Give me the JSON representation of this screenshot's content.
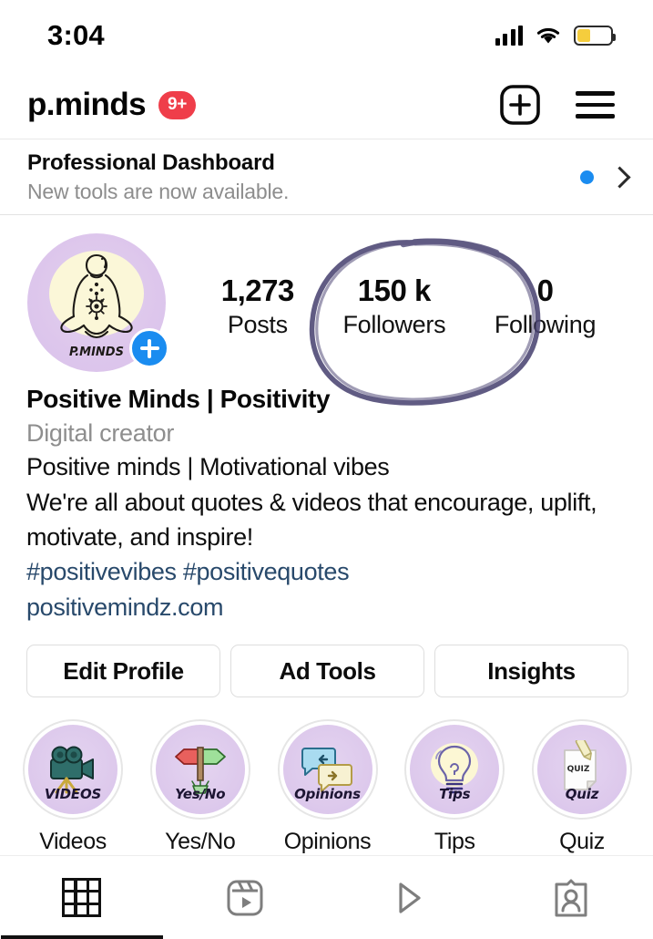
{
  "status_bar": {
    "time": "3:04",
    "signal_icon": "cellular-bars-icon",
    "wifi_icon": "wifi-icon",
    "battery_icon": "battery-icon",
    "battery_level_percent": 40,
    "battery_color": "#f5cd3d"
  },
  "header": {
    "username": "p.minds",
    "notification_badge": "9+",
    "badge_color": "#ef3e4a",
    "add_icon": "plus-square-icon",
    "menu_icon": "hamburger-menu-icon"
  },
  "dashboard": {
    "title": "Professional Dashboard",
    "subtitle": "New tools are now available.",
    "dot_color": "#1a8cf0",
    "chevron_icon": "chevron-right-icon"
  },
  "profile": {
    "avatar_name": "profile-avatar",
    "avatar_caption": "P.MINDS",
    "add_story_icon": "plus-icon",
    "stats": [
      {
        "value": "1,273",
        "label": "Posts"
      },
      {
        "value": "150 k",
        "label": "Followers"
      },
      {
        "value": "0",
        "label": "Following"
      }
    ],
    "annotation": {
      "type": "hand-drawn-circle",
      "color": "#4b4573",
      "targets": "Followers stat"
    }
  },
  "bio": {
    "display_name": "Positive Minds | Positivity",
    "category": "Digital creator",
    "lines": [
      "Positive minds | Motivational vibes",
      "We're all about quotes & videos that encourage, uplift,",
      "motivate, and inspire!"
    ],
    "hashtags": "#positivevibes #positivequotes",
    "website": "positivemindz.com",
    "link_color": "#28496b"
  },
  "actions": [
    {
      "label": "Edit Profile"
    },
    {
      "label": "Ad Tools"
    },
    {
      "label": "Insights"
    }
  ],
  "highlights": [
    {
      "label": "Videos",
      "cover_caption": "VIDEOS",
      "icon": "video-camera-icon"
    },
    {
      "label": "Yes/No",
      "cover_caption": "Yes/No",
      "icon": "signpost-arrows-icon"
    },
    {
      "label": "Opinions",
      "cover_caption": "Opinions",
      "icon": "speech-bubbles-icon"
    },
    {
      "label": "Tips",
      "cover_caption": "Tips",
      "icon": "lightbulb-icon"
    },
    {
      "label": "Quiz",
      "cover_caption": "Quiz",
      "icon": "quiz-note-icon"
    }
  ],
  "bottom_tabs": [
    {
      "name": "grid",
      "icon": "grid-icon",
      "active": true
    },
    {
      "name": "reels",
      "icon": "reels-icon",
      "active": false
    },
    {
      "name": "video",
      "icon": "play-icon",
      "active": false
    },
    {
      "name": "tagged",
      "icon": "tagged-icon",
      "active": false
    }
  ]
}
